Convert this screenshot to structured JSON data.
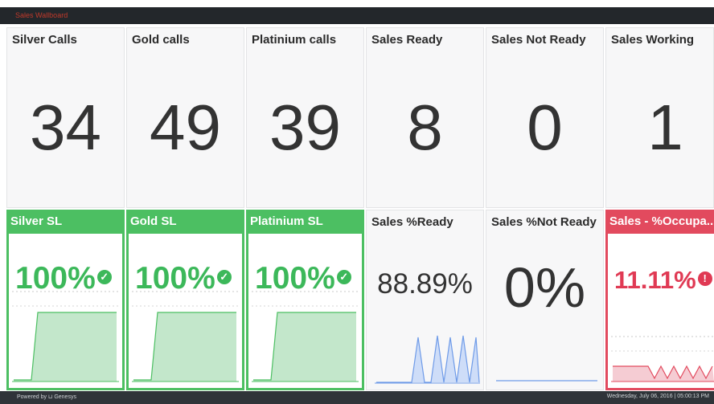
{
  "header": {
    "title": "Sales Wallboard"
  },
  "top_tiles": [
    {
      "label": "Silver Calls",
      "value": "34"
    },
    {
      "label": "Gold calls",
      "value": "49"
    },
    {
      "label": "Platinium calls",
      "value": "39"
    },
    {
      "label": "Sales Ready",
      "value": "8"
    },
    {
      "label": "Sales Not Ready",
      "value": "0"
    },
    {
      "label": "Sales Working",
      "value": "1"
    }
  ],
  "sl_tiles": [
    {
      "label": "Silver SL",
      "value": "100%",
      "check_icon": "check-circle-icon",
      "color": "#4cbf62"
    },
    {
      "label": "Gold SL",
      "value": "100%",
      "check_icon": "check-circle-icon",
      "color": "#4cbf62"
    },
    {
      "label": "Platinium SL",
      "value": "100%",
      "check_icon": "check-circle-icon",
      "color": "#4cbf62"
    }
  ],
  "ready_tile": {
    "label": "Sales %Ready",
    "value": "88.89%"
  },
  "notready_tile": {
    "label": "Sales %Not Ready",
    "value": "0%"
  },
  "occupancy_tile": {
    "label": "Sales - %Occupa...",
    "value": "11.11%",
    "color": "#e24a5e"
  },
  "footer": {
    "left": "Powered by ⊔ Genesys",
    "right": "Wednesday, July 06, 2016 | 05:00:13 PM"
  },
  "colors": {
    "green": "#4cbf62",
    "red": "#e24a5e",
    "blue": "#6f9be8",
    "titlebar": "#23272b"
  }
}
